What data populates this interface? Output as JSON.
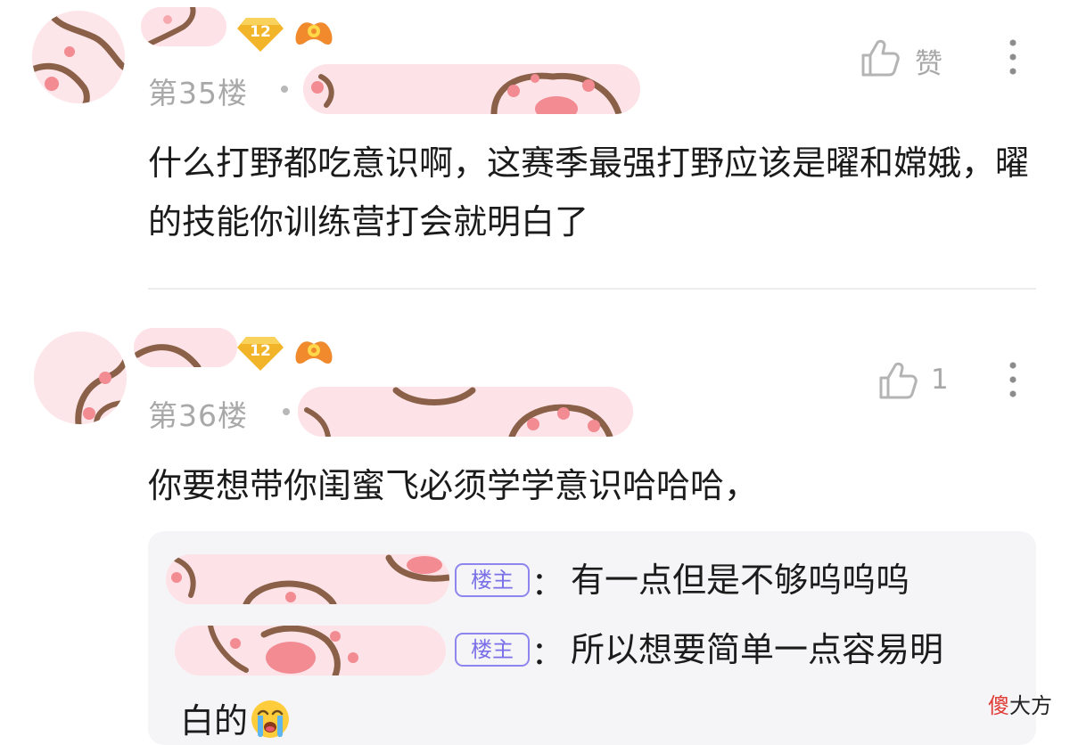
{
  "comments": [
    {
      "floor": "第35楼",
      "level": "12",
      "like_label": "赞",
      "content": "什么打野都吃意识啊，这赛季最强打野应该是曜和嫦娥，曜的技能你训练营打会就明白了"
    },
    {
      "floor": "第36楼",
      "level": "12",
      "like_label": "1",
      "content": "你要想带你闺蜜飞必须学学意识哈哈哈，",
      "replies": [
        {
          "tag": "楼主",
          "colon": "：",
          "text": "有一点但是不够呜呜呜"
        },
        {
          "tag": "楼主",
          "colon": "：",
          "text_line1": "所以想要简单一点容易明",
          "text_line2": "白的",
          "emoji": "loudly-crying-face"
        }
      ]
    }
  ],
  "watermark": {
    "char1": "傻",
    "rest": "大方"
  },
  "colors": {
    "owner_tag": "#7a70e8",
    "muted_text": "#a8a8a8",
    "blur_pink": "#fde3e8",
    "paw_brown": "#8a6048",
    "paw_pad": "#f28b92"
  }
}
